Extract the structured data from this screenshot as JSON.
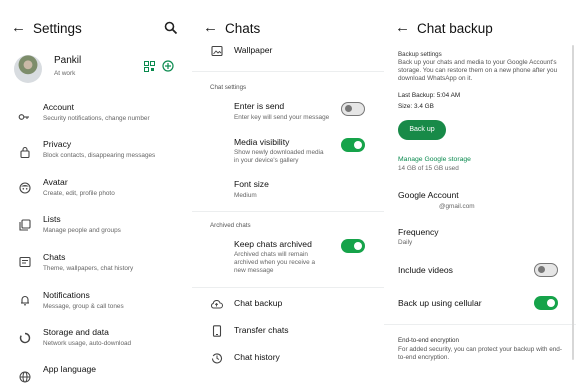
{
  "settings": {
    "title": "Settings",
    "profile": {
      "name": "Pankil",
      "status": "At work"
    },
    "items": [
      {
        "title": "Account",
        "subtitle": "Security notifications, change number",
        "icon": "key-icon"
      },
      {
        "title": "Privacy",
        "subtitle": "Block contacts, disappearing messages",
        "icon": "lock-icon"
      },
      {
        "title": "Avatar",
        "subtitle": "Create, edit, profile photo",
        "icon": "avatar-icon"
      },
      {
        "title": "Lists",
        "subtitle": "Manage people and groups",
        "icon": "lists-icon"
      },
      {
        "title": "Chats",
        "subtitle": "Theme, wallpapers, chat history",
        "icon": "chat-icon"
      },
      {
        "title": "Notifications",
        "subtitle": "Message, group & call tones",
        "icon": "bell-icon"
      },
      {
        "title": "Storage and data",
        "subtitle": "Network usage, auto-download",
        "icon": "storage-icon"
      },
      {
        "title": "App language",
        "subtitle": "",
        "icon": "globe-icon"
      }
    ]
  },
  "chats": {
    "title": "Chats",
    "wallpaper": "Wallpaper",
    "chat_settings_header": "Chat settings",
    "enter_is_send": {
      "title": "Enter is send",
      "subtitle": "Enter key will send your message",
      "on": false
    },
    "media_visibility": {
      "title": "Media visibility",
      "subtitle": "Show newly downloaded media in your device's gallery",
      "on": true
    },
    "font_size": {
      "title": "Font size",
      "subtitle": "Medium"
    },
    "archived_header": "Archived chats",
    "keep_archived": {
      "title": "Keep chats archived",
      "subtitle": "Archived chats will remain archived when you receive a new message",
      "on": true
    },
    "chat_backup": "Chat backup",
    "transfer_chats": "Transfer chats",
    "chat_history": "Chat history"
  },
  "backup": {
    "title": "Chat backup",
    "settings_header": "Backup settings",
    "description": "Back up your chats and media to your Google Account's storage. You can restore them on a new phone after you download WhatsApp on it.",
    "last_backup": "Last Backup: 5:04 AM",
    "size": "Size: 3.4 GB",
    "back_up_button": "Back up",
    "manage_storage": "Manage Google storage",
    "storage_used": "14 GB of 15 GB used",
    "google_account_title": "Google Account",
    "google_account_value": "@gmail.com",
    "frequency_title": "Frequency",
    "frequency_value": "Daily",
    "include_videos": {
      "title": "Include videos",
      "on": false
    },
    "cellular": {
      "title": "Back up using cellular",
      "on": true
    },
    "e2e_title": "End-to-end encryption",
    "e2e_subtitle": "For added security, you can protect your backup with end-to-end encryption."
  },
  "colors": {
    "accent": "#16a34a",
    "button": "#188a48",
    "link": "#0a8a4e"
  }
}
